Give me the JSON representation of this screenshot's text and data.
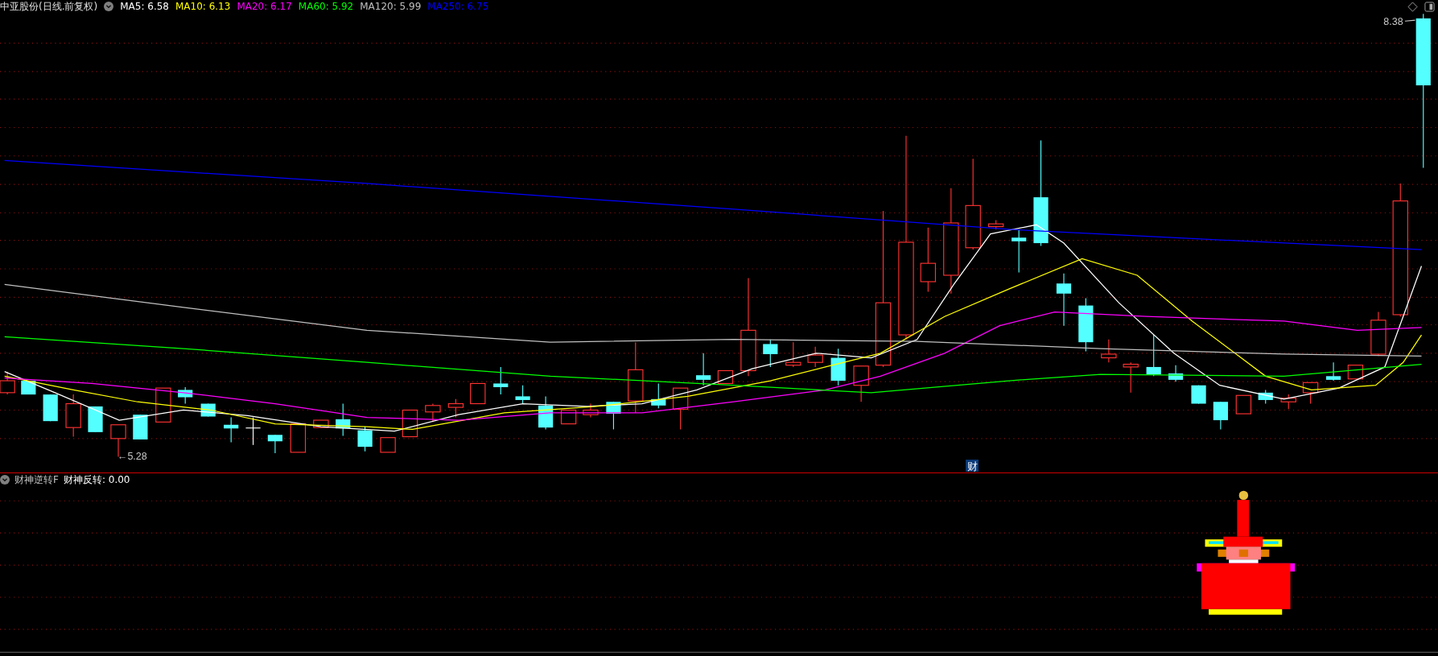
{
  "header": {
    "title": "中亚股份(日线.前复权)",
    "indicators": [
      {
        "label": "MA5: 6.58",
        "color": "#ffffff"
      },
      {
        "label": "MA10: 6.13",
        "color": "#ffff00"
      },
      {
        "label": "MA20: 6.17",
        "color": "#ff00ff"
      },
      {
        "label": "MA60: 5.92",
        "color": "#00ff00"
      },
      {
        "label": "MA120: 5.99",
        "color": "#c0c0c0"
      },
      {
        "label": "MA250: 6.75",
        "color": "#0000ff"
      }
    ]
  },
  "price_chart": {
    "high_label": "8.38",
    "low_label": "←5.28",
    "event_marker": "财"
  },
  "sub_panel": {
    "title": "财神逆转F",
    "indicators": [
      {
        "label": "财神反转: 0.00",
        "color": "#ffffff"
      }
    ]
  }
}
